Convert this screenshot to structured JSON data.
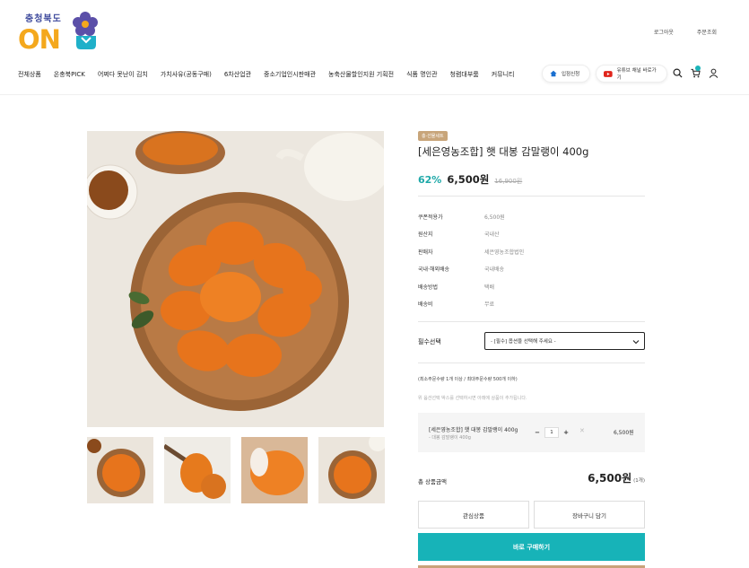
{
  "header": {
    "logo_top_text": "충청북도",
    "logo_text": "ON",
    "top_links": [
      "로그아웃",
      "주문조회"
    ],
    "nav": [
      "전체상품",
      "온충북PICK",
      "어쩌다 못난이 김치",
      "가치사유(공동구매)",
      "6차산업관",
      "중소기업인시판매관",
      "농축산물할인지원 기획전",
      "식품 명인관",
      "청렴대부룸",
      "커뮤니티"
    ],
    "pill_store": "입점신청",
    "pill_youtube": "유튜브 채널 바로가기",
    "accent_color": "#17b3b8"
  },
  "product": {
    "badge": "충·선물세트",
    "title": "[세은영농조합] 햇 대봉 감말랭이 400g",
    "discount": "62%",
    "price": "6,500원",
    "original_price": "16,900원",
    "specs": [
      {
        "key": "쿠폰적용가",
        "value": "6,500원"
      },
      {
        "key": "원산지",
        "value": "국내산"
      },
      {
        "key": "판매자",
        "value": "세은영농조합법인"
      },
      {
        "key": "국내·해외배송",
        "value": "국내배송"
      },
      {
        "key": "배송방법",
        "value": "택배"
      },
      {
        "key": "배송비",
        "value": "무료"
      }
    ]
  },
  "option": {
    "label": "필수선택",
    "placeholder": "- [필수] 옵션을 선택해 주세요 -"
  },
  "notes": {
    "quantity_note": "(최소주문수량 1개 이상 / 최대주문수량 500개 이하)",
    "selection_note": "위 옵션선택 박스를 선택하시면 아래에 상품이 추가됩니다."
  },
  "selected": {
    "name": "[세은영농조합] 햇 대봉 감말랭이 400g",
    "sub": "- 대봉 감말랭이 400g",
    "minus": "−",
    "qty": "1",
    "plus": "+",
    "remove": "✕",
    "price": "6,500원"
  },
  "total": {
    "label": "총 상품금액",
    "value": "6,500원",
    "count": "(1개)"
  },
  "buttons": {
    "wish": "관심상품",
    "cart": "장바구니 담기",
    "buy": "바로 구매하기"
  }
}
